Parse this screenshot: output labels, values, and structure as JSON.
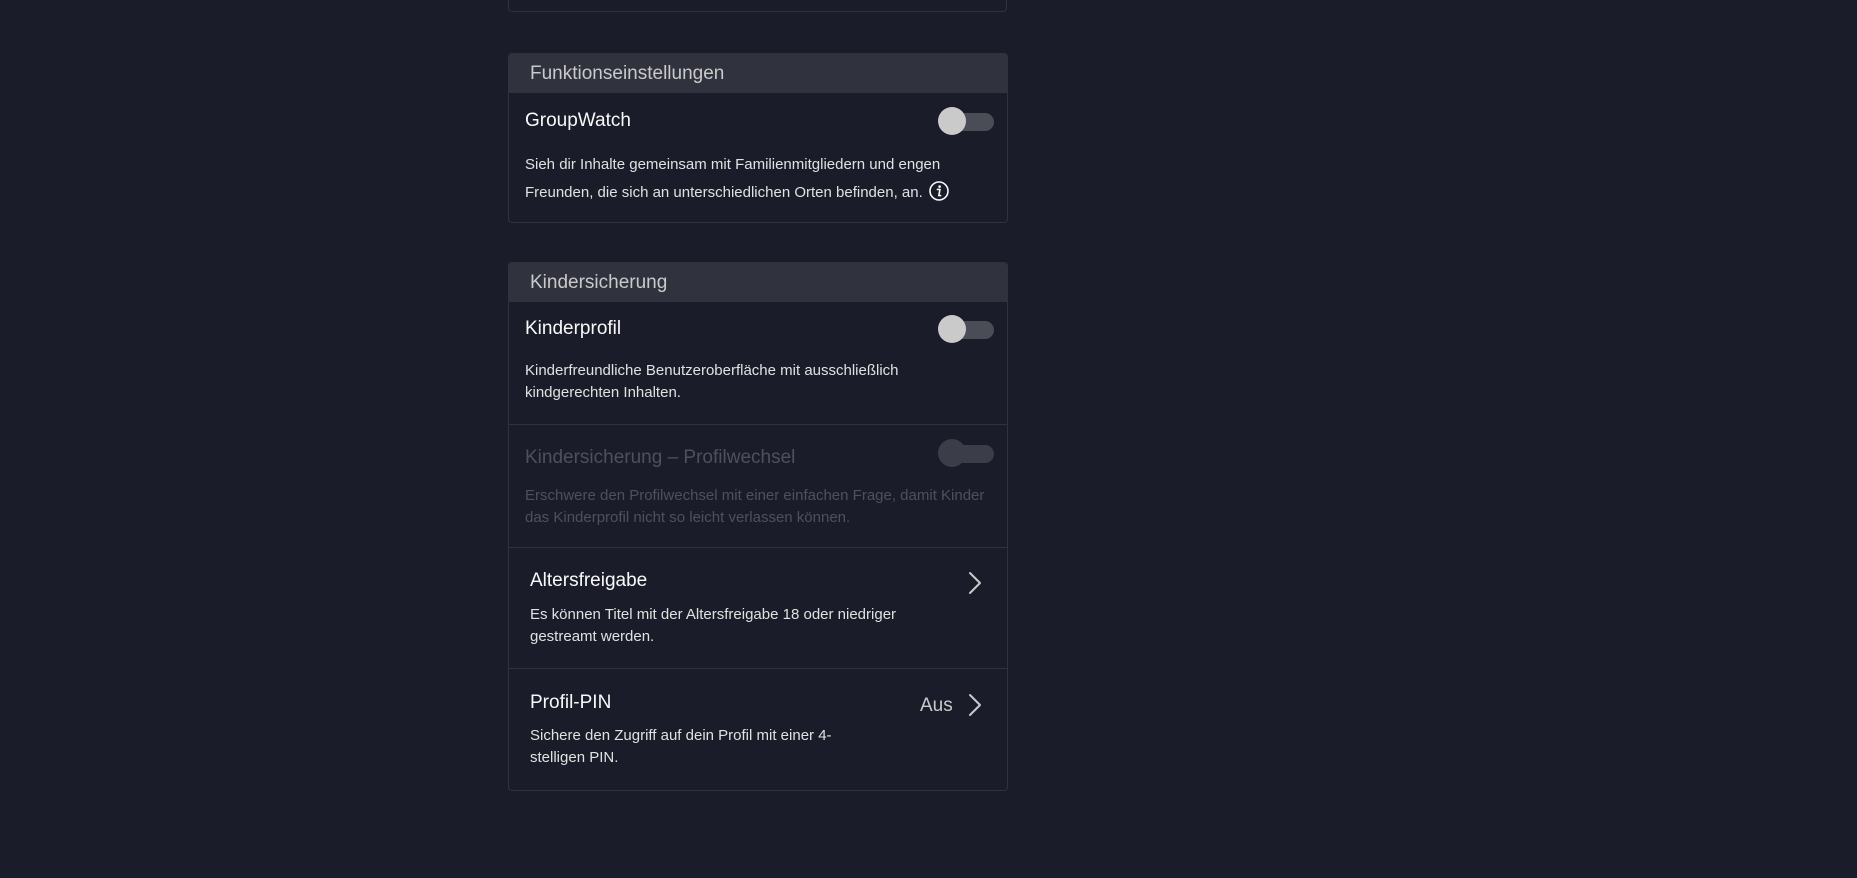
{
  "feature_settings": {
    "header": "Funktionseinstellungen",
    "groupwatch": {
      "title": "GroupWatch",
      "description": "Sieh dir Inhalte gemeinsam mit Familienmitgliedern und engen Freunden, die sich an unterschiedlichen Orten befinden, an.",
      "enabled": false
    }
  },
  "parental_controls": {
    "header": "Kindersicherung",
    "kids_profile": {
      "title": "Kinderprofil",
      "description": "Kinderfreundliche Benutzeroberfläche mit ausschließlich kindgerechten Inhalten.",
      "enabled": false
    },
    "profile_switch_lock": {
      "title": "Kindersicherung – Profilwechsel",
      "description": "Erschwere den Profilwechsel mit einer einfachen Frage, damit Kinder das Kinderprofil nicht so leicht verlassen können.",
      "enabled": false,
      "disabled": true
    },
    "maturity_rating": {
      "title": "Altersfreigabe",
      "description": "Es können Titel mit der Altersfreigabe 18 oder niedriger gestreamt werden."
    },
    "profile_pin": {
      "title": "Profil-PIN",
      "description": "Sichere den Zugriff auf dein Profil mit einer 4-stelligen PIN.",
      "value": "Aus"
    }
  },
  "colors": {
    "background": "#1a1d29",
    "header_bg": "#30323e",
    "border": "#30333e",
    "text_primary": "#f9f9f9",
    "text_disabled": "#4e515c"
  },
  "icons": {
    "info": "info-icon",
    "chevron": "chevron-right-icon"
  }
}
